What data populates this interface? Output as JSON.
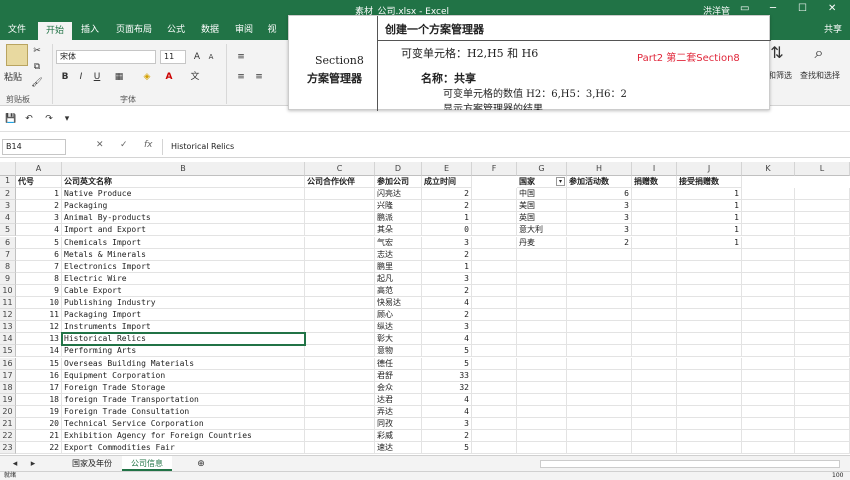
{
  "window": {
    "title": "素材_公司.xlsx - Excel",
    "user": "洪洋管",
    "search_hint": "共享"
  },
  "tabs": [
    {
      "label": "文件"
    },
    {
      "label": "开始"
    },
    {
      "label": "插入"
    },
    {
      "label": "页面布局"
    },
    {
      "label": "公式"
    },
    {
      "label": "数据"
    },
    {
      "label": "审阅"
    },
    {
      "label": "视"
    }
  ],
  "ribbon": {
    "paste": "粘贴",
    "clipboard_group": "剪贴板",
    "font_name": "宋体",
    "font_size": "11",
    "font_group": "字体",
    "sort_filter": "排序和筛选",
    "find_select": "查找和选择"
  },
  "formula_bar": {
    "name_box": "B14",
    "fx": "fx",
    "value": "Historical Relics"
  },
  "overlay": {
    "section": "Section8",
    "manager": "方案管理器",
    "line1": "创建一个方案管理器",
    "line2": "可变单元格：H2,H5 和 H6",
    "part": "Part2 第二套Section8",
    "line3": "名称：共享",
    "line4": "可变单元格的数值 H2：6,H5：3,H6：2",
    "line5": "显示方案管理器的结果"
  },
  "columns": [
    "A",
    "B",
    "C",
    "D",
    "E",
    "F",
    "G",
    "H",
    "I",
    "J",
    "K",
    "L"
  ],
  "headers": {
    "a": "代号",
    "b": "公司英文名称",
    "c": "公司合作伙伴",
    "d": "参加公司",
    "e": "成立时间",
    "g": "国家",
    "h": "参加活动数",
    "i": "捐赠数",
    "j": "接受捐赠数"
  },
  "rows": [
    {
      "n": "2",
      "a": "1",
      "b": "Native Produce",
      "d": "闪亮达",
      "e": "2"
    },
    {
      "n": "3",
      "a": "2",
      "b": "Packaging",
      "d": "兴隆",
      "e": "2"
    },
    {
      "n": "4",
      "a": "3",
      "b": "Animal By-products",
      "d": "鹏派",
      "e": "1"
    },
    {
      "n": "5",
      "a": "4",
      "b": "Import and Export",
      "d": "其朵",
      "e": "0"
    },
    {
      "n": "6",
      "a": "5",
      "b": "Chemicals  Import",
      "d": "气宏",
      "e": "3"
    },
    {
      "n": "7",
      "a": "6",
      "b": "Metals & Minerals",
      "d": "志达",
      "e": "2"
    },
    {
      "n": "8",
      "a": "7",
      "b": "Electronics Import",
      "d": "鹏里",
      "e": "1"
    },
    {
      "n": "9",
      "a": "8",
      "b": "Electric Wire",
      "d": "起凡",
      "e": "3"
    },
    {
      "n": "10",
      "a": "9",
      "b": "Cable Export",
      "d": "高范",
      "e": "2"
    },
    {
      "n": "11",
      "a": "10",
      "b": "Publishing Industry",
      "d": "快易达",
      "e": "4"
    },
    {
      "n": "12",
      "a": "11",
      "b": "Packaging Import",
      "d": "顾心",
      "e": "2"
    },
    {
      "n": "13",
      "a": "12",
      "b": "Instruments Import",
      "d": "纵达",
      "e": "3"
    },
    {
      "n": "14",
      "a": "13",
      "b": "Historical Relics",
      "d": "彰大",
      "e": "4"
    },
    {
      "n": "15",
      "a": "14",
      "b": "Performing Arts",
      "d": "意物",
      "e": "5"
    },
    {
      "n": "16",
      "a": "15",
      "b": "Overseas Building Materials",
      "d": "德任",
      "e": "5"
    },
    {
      "n": "17",
      "a": "16",
      "b": "Equipment Corporation",
      "d": "君舒",
      "e": "33"
    },
    {
      "n": "18",
      "a": "17",
      "b": "Foreign Trade Storage",
      "d": "会众",
      "e": "32"
    },
    {
      "n": "19",
      "a": "18",
      "b": "foreign Trade Transportation",
      "d": "达君",
      "e": "4"
    },
    {
      "n": "20",
      "a": "19",
      "b": "Foreign Trade Consultation",
      "d": "弄达",
      "e": "4"
    },
    {
      "n": "21",
      "a": "20",
      "b": "Technical Service Corporation",
      "d": "同孜",
      "e": "3"
    },
    {
      "n": "22",
      "a": "21",
      "b": "Exhibition Agency for Foreign Countries",
      "d": "彩威",
      "e": "2"
    },
    {
      "n": "23",
      "a": "22",
      "b": "Export Commodities Fair",
      "d": "速达",
      "e": "5"
    }
  ],
  "table2": [
    {
      "g": "中国",
      "h": "6",
      "j": "1"
    },
    {
      "g": "美国",
      "h": "3",
      "j": "1"
    },
    {
      "g": "英国",
      "h": "3",
      "j": "1"
    },
    {
      "g": "意大利",
      "h": "3",
      "j": "1"
    },
    {
      "g": "丹麦",
      "h": "2",
      "j": "1"
    }
  ],
  "sheets": [
    {
      "label": "国家及年份"
    },
    {
      "label": "公司信息"
    }
  ],
  "status": {
    "ready": "就绪",
    "zoom": "100"
  }
}
